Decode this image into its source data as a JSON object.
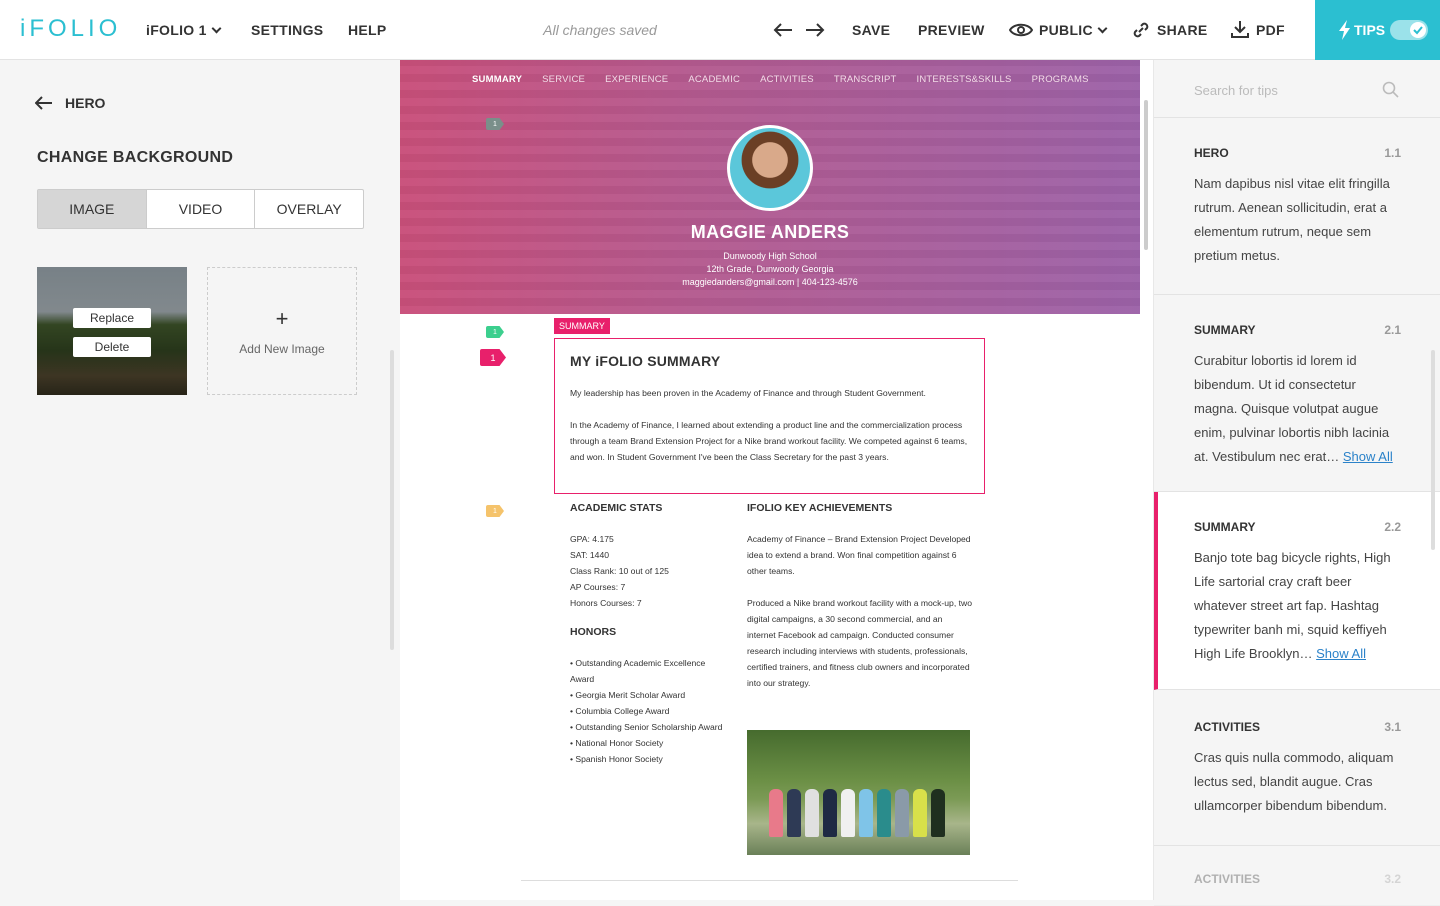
{
  "topbar": {
    "logo": "iFOLIO",
    "folio_menu": "iFOLIO 1",
    "settings": "SETTINGS",
    "help": "HELP",
    "status": "All changes saved",
    "save": "SAVE",
    "preview": "PREVIEW",
    "visibility": "PUBLIC",
    "share": "SHARE",
    "pdf": "PDF",
    "tips": "TIPS",
    "accent": "#2bbfd1"
  },
  "left": {
    "back": "HERO",
    "heading": "CHANGE BACKGROUND",
    "tabs": [
      "IMAGE",
      "VIDEO",
      "OVERLAY"
    ],
    "active_tab": "IMAGE",
    "replace": "Replace",
    "delete": "Delete",
    "add_image": "Add New Image"
  },
  "preview": {
    "nav": [
      "SUMMARY",
      "SERVICE",
      "EXPERIENCE",
      "ACADEMIC",
      "ACTIVITIES",
      "TRANSCRIPT",
      "INTERESTS&SKILLS",
      "PROGRAMS"
    ],
    "name": "MAGGIE ANDERS",
    "school": "Dunwoody High School",
    "grade": "12th Grade, Dunwoody Georgia",
    "contact": "maggiedanders@gmail.com  |  404-123-4576",
    "pins": {
      "hero": "1",
      "green": "1",
      "pink": "1",
      "yellow": "1"
    },
    "summary_tag": "SUMMARY",
    "summary_title": "MY iFOLIO SUMMARY",
    "summary_p1": "My leadership has been proven in the Academy of Finance and through Student Government.",
    "summary_p2": "In the Academy of Finance, I learned about extending a product line and the commercialization process through a team Brand Extension Project for a Nike brand workout facility. We competed against 6 teams, and won. In Student Government I've been the Class Secretary for the past 3 years.",
    "stats_title": "ACADEMIC STATS",
    "stats": [
      "GPA: 4.175",
      "SAT: 1440",
      "Class Rank: 10 out of 125",
      "AP Courses: 7",
      "Honors Courses: 7"
    ],
    "honors_title": "HONORS",
    "honors": [
      "• Outstanding Academic Excellence Award",
      "• Georgia Merit Scholar Award",
      "• Columbia College Award",
      "• Outstanding Senior Scholarship Award",
      "• National Honor Society",
      "• Spanish Honor Society"
    ],
    "ach_title": "IFOLIO KEY ACHIEVEMENTS",
    "ach_p1": "Academy of Finance – Brand Extension Project Developed idea to extend a brand.  Won final competition against 6 other teams.",
    "ach_p2": "Produced a Nike brand workout facility with a mock-up, two digital campaigns, a 30 second commercial, and an internet Facebook ad campaign. Conducted consumer research including interviews with students, professionals, certified trainers, and fitness club owners and incorporated into our strategy."
  },
  "right": {
    "search_placeholder": "Search for tips",
    "tips": [
      {
        "title": "HERO",
        "num": "1.1",
        "body": "Nam dapibus nisl vitae elit fringilla rutrum. Aenean sollicitudin, erat a elementum rutrum, neque sem pretium metus.",
        "link": ""
      },
      {
        "title": "SUMMARY",
        "num": "2.1",
        "body": "Curabitur lobortis id lorem id bibendum. Ut id consectetur magna. Quisque volutpat augue enim, pulvinar lobortis nibh lacinia at. Vestibulum nec erat…",
        "link": "Show All"
      },
      {
        "title": "SUMMARY",
        "num": "2.2",
        "body": "Banjo tote bag bicycle rights, High Life sartorial cray craft beer whatever street art fap. Hashtag typewriter banh mi, squid keffiyeh High Life Brooklyn…",
        "link": "Show All"
      },
      {
        "title": "ACTIVITIES",
        "num": "3.1",
        "body": "Cras quis nulla commodo, aliquam lectus sed, blandit augue. Cras ullamcorper bibendum bibendum.",
        "link": ""
      },
      {
        "title": "ACTIVITIES",
        "num": "3.2",
        "body": "",
        "link": ""
      }
    ],
    "active_color": "#e8206b"
  }
}
